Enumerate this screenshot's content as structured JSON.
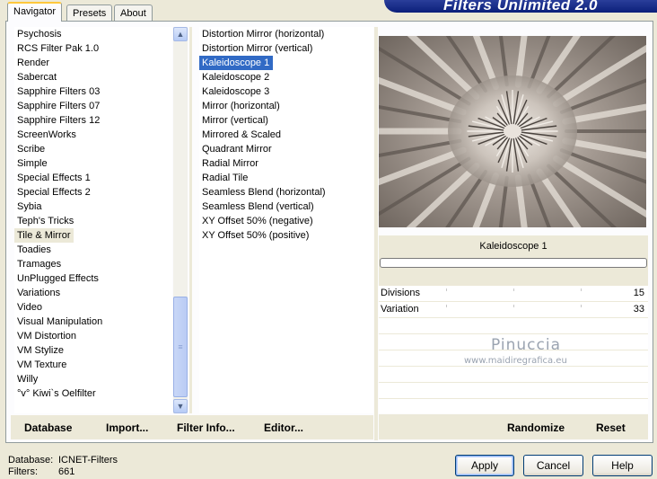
{
  "banner": {
    "title": "Filters Unlimited 2.0"
  },
  "tabs": [
    {
      "label": "Navigator",
      "active": true
    },
    {
      "label": "Presets",
      "active": false
    },
    {
      "label": "About",
      "active": false
    }
  ],
  "categories": {
    "items": [
      "Psychosis",
      "RCS Filter Pak 1.0",
      "Render",
      "Sabercat",
      "Sapphire Filters 03",
      "Sapphire Filters 07",
      "Sapphire Filters 12",
      "ScreenWorks",
      "Scribe",
      "Simple",
      "Special Effects 1",
      "Special Effects 2",
      "Sybia",
      "Teph's Tricks",
      "Tile & Mirror",
      "Toadies",
      "Tramages",
      "UnPlugged Effects",
      "Variations",
      "Video",
      "Visual Manipulation",
      "VM Distortion",
      "VM Stylize",
      "VM Texture",
      "Willy",
      "°v° Kiwi`s Oelfilter"
    ],
    "selected_index": 14
  },
  "filters": {
    "items": [
      "Distortion Mirror (horizontal)",
      "Distortion Mirror (vertical)",
      "Kaleidoscope 1",
      "Kaleidoscope 2",
      "Kaleidoscope 3",
      "Mirror (horizontal)",
      "Mirror (vertical)",
      "Mirrored & Scaled",
      "Quadrant Mirror",
      "Radial Mirror",
      "Radial Tile",
      "Seamless Blend (horizontal)",
      "Seamless Blend (vertical)",
      "XY Offset 50% (negative)",
      "XY Offset 50% (positive)"
    ],
    "selected_index": 2
  },
  "toolbar": {
    "database": "Database",
    "import": "Import...",
    "filter_info": "Filter Info...",
    "editor": "Editor..."
  },
  "filter_panel": {
    "name": "Kaleidoscope 1",
    "params": [
      {
        "label": "Divisions",
        "value": "15"
      },
      {
        "label": "Variation",
        "value": "33"
      }
    ],
    "watermark_name": "Pinuccia",
    "watermark_url": "www.maidiregrafica.eu",
    "randomize": "Randomize",
    "reset": "Reset"
  },
  "status": {
    "database_label": "Database:",
    "database_value": "ICNET-Filters",
    "filters_label": "Filters:",
    "filters_value": "661"
  },
  "buttons": {
    "apply": "Apply",
    "cancel": "Cancel",
    "help": "Help"
  },
  "colors": {
    "selection": "#316ac5",
    "banner": "#0b1f7a",
    "face": "#ece9d8"
  },
  "icons": {
    "scroll_up": "chevron-up-icon",
    "scroll_down": "chevron-down-icon"
  }
}
